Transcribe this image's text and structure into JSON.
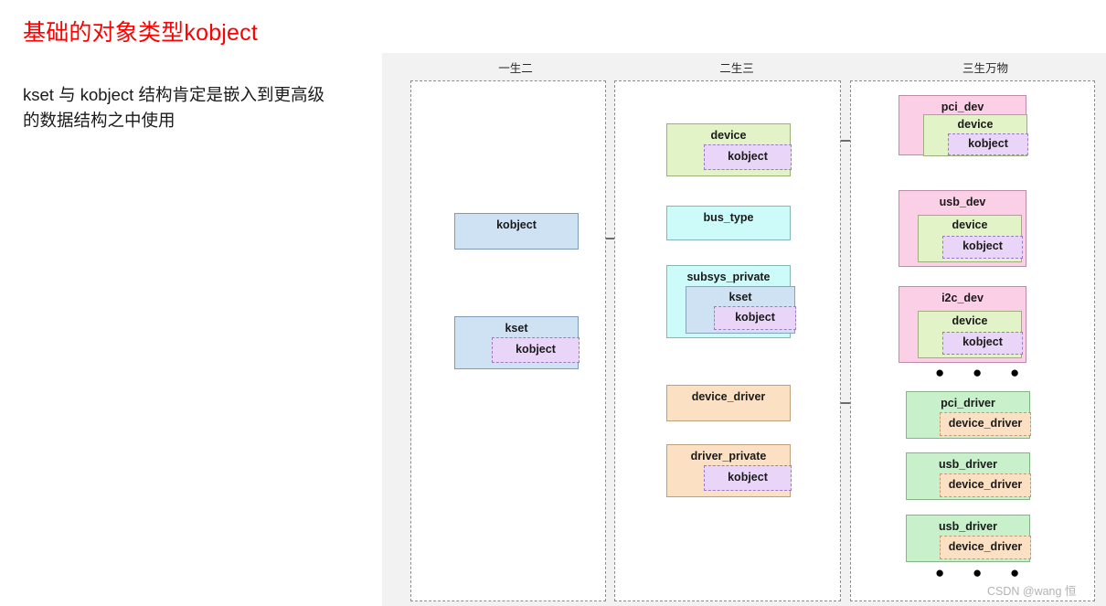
{
  "slide": {
    "title": "基础的对象类型kobject",
    "subtitle": "kset 与 kobject 结构肯定是嵌入到更高级的数据结构之中使用",
    "title_color": "#ff0000",
    "background": "#ffffff"
  },
  "diagram": {
    "background": "#f2f2f2",
    "columns": [
      {
        "header": "一生二"
      },
      {
        "header": "二生三"
      },
      {
        "header": "三生万物"
      }
    ],
    "ellipsis": "● ● ●",
    "nodes": {
      "kobject": "kobject",
      "kset": "kset",
      "kset_kobject": "kobject",
      "device": "device",
      "device_kobject": "kobject",
      "bus_type": "bus_type",
      "subsys_private": "subsys_private",
      "subsys_kset": "kset",
      "subsys_kobject": "kobject",
      "device_driver": "device_driver",
      "driver_private": "driver_private",
      "driver_private_kobject": "kobject",
      "pci_dev": "pci_dev",
      "pci_dev_device": "device",
      "pci_dev_kobject": "kobject",
      "usb_dev": "usb_dev",
      "usb_dev_device": "device",
      "usb_dev_kobject": "kobject",
      "i2c_dev": "i2c_dev",
      "i2c_dev_device": "device",
      "i2c_dev_kobject": "kobject",
      "pci_driver": "pci_driver",
      "pci_driver_inner": "device_driver",
      "usb_driver_1": "usb_driver",
      "usb_driver_1_inner": "device_driver",
      "usb_driver_2": "usb_driver",
      "usb_driver_2_inner": "device_driver"
    },
    "colors": {
      "blue": "#cfe2f3",
      "green": "#e2f3c8",
      "cyan": "#ccfbf9",
      "orange": "#fbe0c4",
      "purple": "#e9d5f7",
      "pink": "#fbcfe5",
      "mint": "#c8f0ca",
      "panel_border": "#8c8c8c",
      "arrow": "#404040"
    }
  },
  "watermark": "CSDN @wang 恒"
}
